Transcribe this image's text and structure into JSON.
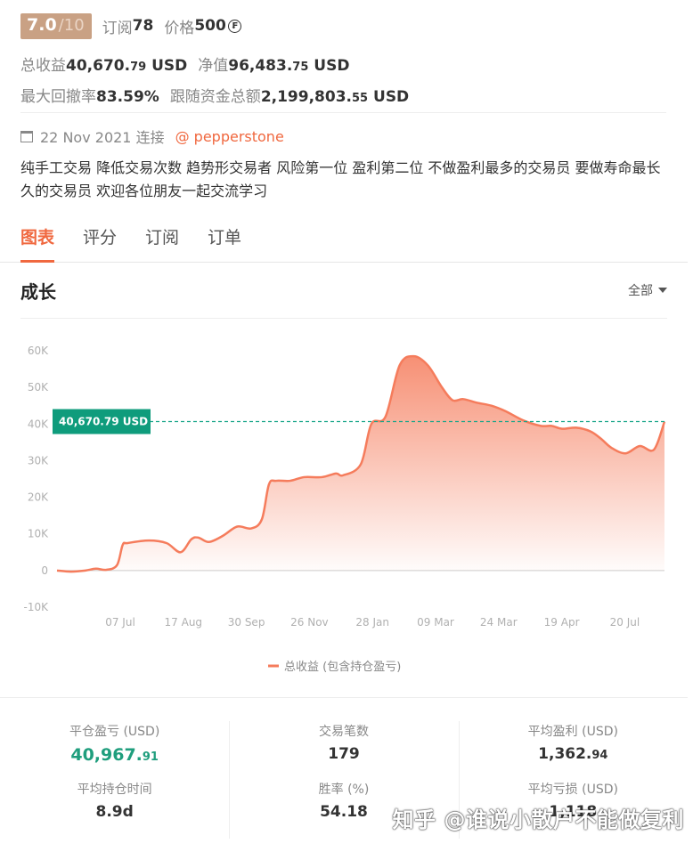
{
  "header": {
    "score": "7.0",
    "score_total": "/10",
    "subscribe_label": "订阅",
    "subscribe_count": "78",
    "price_label": "价格",
    "price_value": "500",
    "price_icon": "coin-icon"
  },
  "stats_top": {
    "total_profit_label": "总收益",
    "total_profit_int": "40,670.",
    "total_profit_dec": "79",
    "total_profit_unit": " USD",
    "net_value_label": "净值",
    "net_value_int": "96,483.",
    "net_value_dec": "75",
    "net_value_unit": " USD",
    "max_drawdown_label": "最大回撤率",
    "max_drawdown_value": "83.59%",
    "follow_funds_label": "跟随资金总额",
    "follow_funds_int": "2,199,803.",
    "follow_funds_dec": "55",
    "follow_funds_unit": " USD"
  },
  "meta": {
    "date_text": "22 Nov 2021 连接",
    "broker": "@ pepperstone",
    "description": "纯手工交易 降低交易次数 趋势形交易者 风险第一位 盈利第二位 不做盈利最多的交易员 要做寿命最长久的交易员 欢迎各位朋友一起交流学习"
  },
  "tabs": [
    {
      "label": "图表",
      "active": true
    },
    {
      "label": "评分",
      "active": false
    },
    {
      "label": "订阅",
      "active": false
    },
    {
      "label": "订单",
      "active": false
    }
  ],
  "growth": {
    "title": "成长",
    "range_label": "全部"
  },
  "chart_data": {
    "type": "area",
    "title": "",
    "xlabel": "",
    "ylabel": "",
    "ylim": [
      -10000,
      60000
    ],
    "y_ticks": [
      "60K",
      "50K",
      "40K",
      "30K",
      "20K",
      "10K",
      "0",
      "-10K"
    ],
    "y_tick_values": [
      60000,
      50000,
      40000,
      30000,
      20000,
      10000,
      0,
      -10000
    ],
    "x_ticks": [
      "07 Jul",
      "17 Aug",
      "30 Sep",
      "26 Nov",
      "28 Jan",
      "09 Mar",
      "24 Mar",
      "19 Apr",
      "20 Jul"
    ],
    "current_value_label": "40,670.79 USD",
    "current_value": 40670.79,
    "legend": "总收益 (包含持仓盈亏)",
    "legend_position": "bottom",
    "color": "#f57c5c",
    "series": [
      {
        "name": "总收益 (包含持仓盈亏)",
        "x": [
          0,
          0.2,
          0.4,
          0.55,
          0.7,
          0.85,
          0.93,
          1.0,
          1.3,
          1.55,
          1.75,
          1.9,
          2.0,
          2.15,
          2.35,
          2.55,
          2.75,
          2.9,
          3.0,
          3.1,
          3.3,
          3.5,
          3.75,
          3.95,
          4.05,
          4.3,
          4.45,
          4.65,
          4.85,
          5.05,
          5.25,
          5.45,
          5.6,
          5.75,
          5.95,
          6.15,
          6.35,
          6.6,
          6.85,
          7.0,
          7.15,
          7.35,
          7.55,
          7.7,
          7.85,
          8.05,
          8.25,
          8.45,
          8.6
        ],
        "y": [
          0,
          -300,
          0,
          500,
          200,
          1500,
          7000,
          7500,
          8200,
          7500,
          5000,
          8500,
          9000,
          7800,
          9500,
          12000,
          11500,
          14000,
          23500,
          24500,
          24500,
          25500,
          25500,
          26500,
          26000,
          29000,
          40000,
          42000,
          56000,
          58500,
          56000,
          50000,
          46500,
          46800,
          45800,
          45000,
          43500,
          41000,
          39500,
          39500,
          38700,
          39000,
          38000,
          36000,
          33500,
          32000,
          34000,
          33000,
          40670.79
        ]
      }
    ]
  },
  "stats_bottom": [
    [
      {
        "label": "平仓盈亏 (USD)",
        "int": "40,967.",
        "dec": "91",
        "green": true
      },
      {
        "label": "平均持仓时间",
        "int": "8.9d",
        "dec": "",
        "green": false
      }
    ],
    [
      {
        "label": "交易笔数",
        "int": "179",
        "dec": "",
        "green": false
      },
      {
        "label": "胜率 (%)",
        "int": "54.18",
        "dec": "",
        "green": false
      }
    ],
    [
      {
        "label": "平均盈利 (USD)",
        "int": "1,362.",
        "dec": "94",
        "green": false
      },
      {
        "label": "平均亏损 (USD)",
        "int": "1,118",
        "dec": "",
        "green": false
      }
    ]
  ],
  "watermark": "知乎 @谁说小散户不能做复利"
}
